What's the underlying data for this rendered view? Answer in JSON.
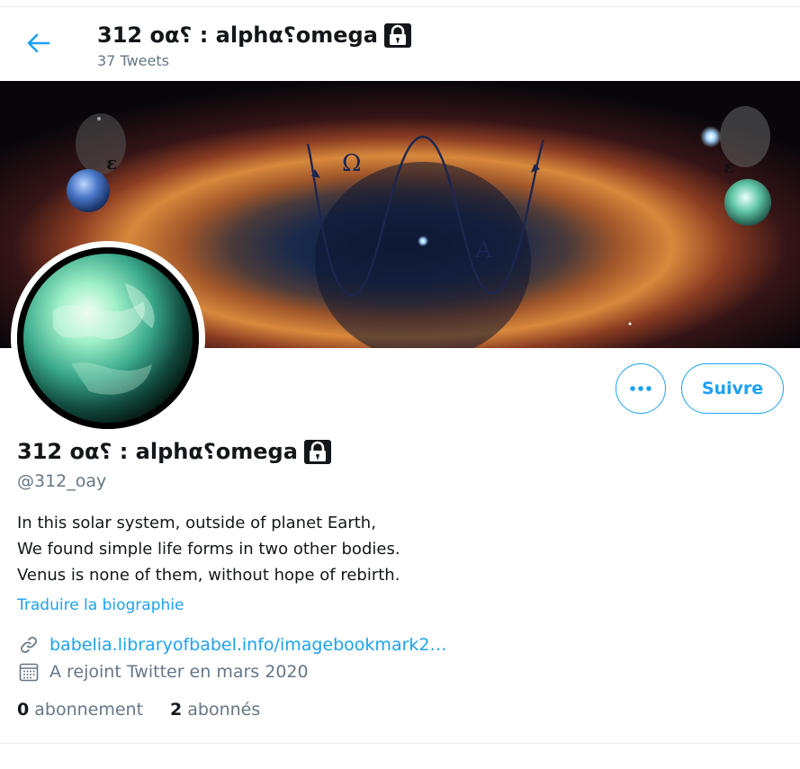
{
  "header": {
    "title": "312 οα⸮ : alphα⸮οmega",
    "tweet_count": "37 Tweets"
  },
  "banner": {
    "labels": [
      "ε",
      "Ω",
      "Α",
      "ε"
    ]
  },
  "profile": {
    "name": "312 οα⸮ : alphα⸮οmega",
    "handle": "@312_oay",
    "bio": [
      "In this solar system, outside of planet Earth,",
      "We found simple life forms in two other bodies.",
      "Venus is none of them, without hope of rebirth."
    ],
    "translate_label": "Traduire la biographie",
    "link": "babelia.libraryofbabel.info/imagebookmark2…",
    "joined": "A rejoint Twitter en mars 2020",
    "following_count": "0",
    "following_label": "abonnement",
    "followers_count": "2",
    "followers_label": "abonnés"
  },
  "actions": {
    "more_label": "•••",
    "follow_label": "Suivre"
  },
  "colors": {
    "accent": "#1da1f2",
    "text": "#14171a",
    "muted": "#657786"
  }
}
